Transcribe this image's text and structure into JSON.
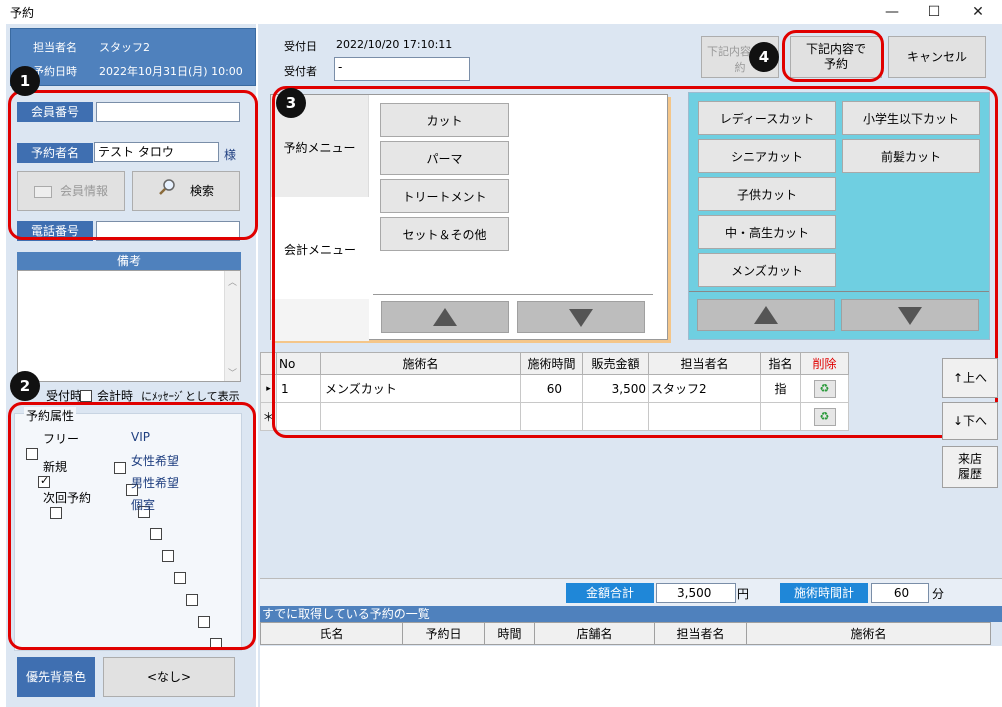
{
  "window": {
    "title": "予約",
    "minimize": "—",
    "maximize": "☐",
    "close": "✕"
  },
  "staff": {
    "label_name": "担当者名",
    "name": "スタッフ2",
    "label_datetime": "予約日時",
    "datetime": "2022年10月31日(月) 10:00"
  },
  "member": {
    "number_label": "会員番号",
    "number_value": "",
    "booker_label": "予約者名",
    "booker_value": "テスト タロウ",
    "sama": "様",
    "info_button": "会員情報",
    "search_button": "検索",
    "phone_label": "電話番号",
    "phone_value": ""
  },
  "memo": {
    "title": "備考",
    "opt_reception": "受付時",
    "opt_checkout": "会計時",
    "opt_suffix": "にﾒｯｾｰｼﾞとして表示"
  },
  "attributes": {
    "title": "予約属性",
    "left": [
      {
        "label": "フリー",
        "checked": false
      },
      {
        "label": "新規",
        "checked": true
      },
      {
        "label": "次回予約",
        "checked": false
      }
    ],
    "right": [
      {
        "label": "VIP",
        "checked": false
      },
      {
        "label": "女性希望",
        "checked": false
      },
      {
        "label": "男性希望",
        "checked": false
      },
      {
        "label": "個室",
        "checked": false
      }
    ]
  },
  "priority": {
    "label": "優先背景色",
    "value": "<なし>"
  },
  "reception": {
    "date_label": "受付日",
    "date_value": "2022/10/20 17:10:11",
    "person_label": "受付者",
    "person_value": "-"
  },
  "actions": {
    "reserve_disabled": "下記内容で予約",
    "reserve": "下記内容で\n予約",
    "cancel": "キャンセル"
  },
  "menu": {
    "tabs": [
      "予約メニュー",
      "会計メニュー"
    ],
    "categories": [
      "カット",
      "パーマ",
      "トリートメント",
      "セット＆その他"
    ]
  },
  "items": {
    "left": [
      "レディースカット",
      "シニアカット",
      "子供カット",
      "中・高生カット",
      "メンズカット"
    ],
    "right": [
      "小学生以下カット",
      "前髪カット"
    ]
  },
  "grid": {
    "columns": [
      "No",
      "施術名",
      "施術時間",
      "販売金額",
      "担当者名",
      "指名",
      "削除"
    ],
    "rows": [
      {
        "no": "1",
        "name": "メンズカット",
        "time": "60",
        "price": "3,500",
        "staff": "スタッフ2",
        "nominate": "指"
      }
    ],
    "new_row_marker": "＊"
  },
  "side_buttons": {
    "up": "↑上へ",
    "down": "↓下へ",
    "history": "来店\n履歴"
  },
  "totals": {
    "amount_label": "金額合計",
    "amount": "3,500",
    "yen": "円",
    "time_label": "施術時間計",
    "time": "60",
    "minutes": "分"
  },
  "list": {
    "title": "すでに取得している予約の一覧",
    "columns": [
      "氏名",
      "予約日",
      "時間",
      "店舗名",
      "担当者名",
      "施術名"
    ]
  },
  "badges": [
    "1",
    "2",
    "3",
    "4"
  ]
}
